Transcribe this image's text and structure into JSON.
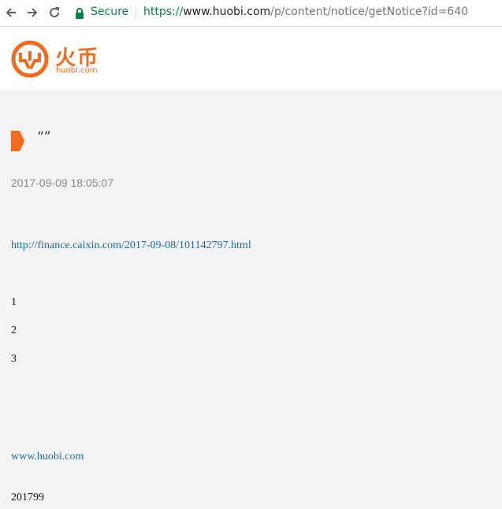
{
  "browser": {
    "secure_label": "Secure",
    "url_scheme": "https://",
    "url_host": "www.huobi.com",
    "url_path": "/p/content/notice/getNotice?id=640"
  },
  "header": {
    "logo_cn": "火币",
    "logo_en": "huobi.com"
  },
  "article": {
    "title": "“”",
    "date": "2017-09-09 18:05:07",
    "source_link": "http://finance.caixin.com/2017-09-08/101142797.html",
    "items": [
      "1",
      "2",
      "3"
    ],
    "site_link": "www.huobi.com",
    "footer_text": "201799"
  },
  "colors": {
    "brand": "#f26b1d",
    "link": "#1a6ca8",
    "secure": "#0b8043"
  }
}
